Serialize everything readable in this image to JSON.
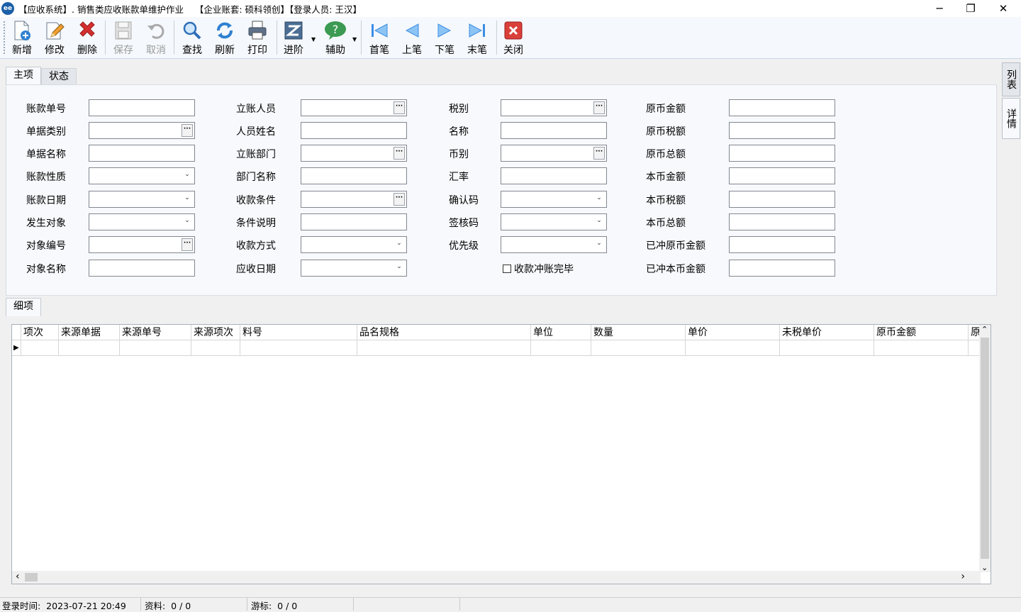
{
  "window": {
    "title": "【应收系统】. 销售类应收账款单维护作业    【企业账套: 硕科领创】【登录人员: 王汉】",
    "app_icon": "ee",
    "controls": {
      "minimize": "─",
      "restore": "❐",
      "close": "✕"
    }
  },
  "toolbar": {
    "new": "新增",
    "edit": "修改",
    "delete": "删除",
    "save": "保存",
    "cancel": "取消",
    "find": "查找",
    "refresh": "刷新",
    "print": "打印",
    "advance": "进阶",
    "assist": "辅助",
    "first": "首笔",
    "prev": "上笔",
    "next": "下笔",
    "last": "末笔",
    "close": "关闭"
  },
  "tabs": {
    "main": "主项",
    "status": "状态",
    "detail": "细项"
  },
  "side_tabs": {
    "list": "列表",
    "detail": "详情"
  },
  "form": {
    "col1": [
      "账款单号",
      "单据类别",
      "单据名称",
      "账款性质",
      "账款日期",
      "发生对象",
      "对象编号",
      "对象名称"
    ],
    "col2": [
      "立账人员",
      "人员姓名",
      "立账部门",
      "部门名称",
      "收款条件",
      "条件说明",
      "收款方式",
      "应收日期"
    ],
    "col3": [
      "税别",
      "名称",
      "币别",
      "汇率",
      "确认码",
      "签核码",
      "优先级"
    ],
    "col4": [
      "原币金额",
      "原币税额",
      "原币总额",
      "本币金额",
      "本币税额",
      "本币总额",
      "已冲原币金额",
      "已冲本币金额"
    ],
    "checkbox_label": "收款冲账完毕",
    "lookup_glyph": "···",
    "dropdown_glyph": "⌄"
  },
  "grid": {
    "columns": [
      "项次",
      "来源单据",
      "来源单号",
      "来源项次",
      "料号",
      "品名规格",
      "单位",
      "数量",
      "单价",
      "未税单价",
      "原币金额",
      "原"
    ],
    "row_indicator": "▶",
    "scroll_up": "⌃",
    "scroll_down": "⌄",
    "scroll_left": "‹",
    "scroll_right": "›"
  },
  "statusbar": {
    "login_time": "登录时间:  2023-07-21 20:49",
    "records": "资料:  0 / 0",
    "cursor": "游标:  0 / 0"
  },
  "colors": {
    "accent": "#1b5fa8",
    "delete_red": "#d32f2f",
    "nav_blue": "#3d8ee6"
  }
}
